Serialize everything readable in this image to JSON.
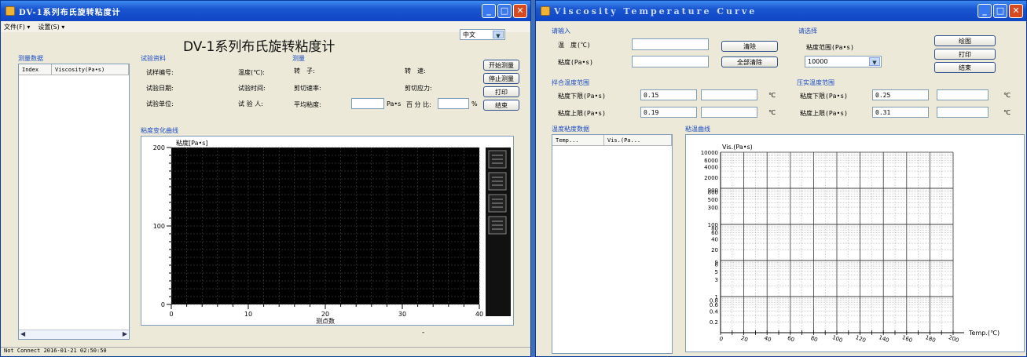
{
  "w1": {
    "title": "DV-1系列布氏旋转粘度计",
    "menu": [
      "文件(F) ▾",
      "设置(S) ▾"
    ],
    "lang": "中文",
    "big_title": "DV-1系列布氏旋转粘度计",
    "measure_data_group": "测量数据",
    "list_headers": [
      "Index",
      "Viscosity(Pa•s)"
    ],
    "test_info_group": "试验资料",
    "test_info": {
      "sample_no": "试样编号:",
      "temperature": "温度(℃):",
      "test_date": "试验日期:",
      "test_time": "试验时间:",
      "test_unit": "试验单位:",
      "tester": "试 验 人:"
    },
    "measure_group": "测量",
    "measure": {
      "rotor": "转　子:",
      "speed": "转　速:",
      "shear_rate": "剪切速率:",
      "shear_stress": "剪切应力:",
      "avg_visc": "平均粘度:",
      "unit_pas": "Pa•s",
      "percent": "百 分 比:",
      "pct_sym": "%"
    },
    "buttons": {
      "start": "开始测量",
      "stop": "停止测量",
      "print": "打印",
      "end": "结束"
    },
    "curve_group": "粘度变化曲线",
    "status": "Not Connect   2016-01-21 02:50:50"
  },
  "w1_chart": {
    "type": "line",
    "ylabel": "粘度[Pa•s]",
    "xlabel": "测点数",
    "xlim": [
      0,
      40
    ],
    "ylim": [
      0,
      200
    ],
    "x_ticks": [
      0,
      10,
      20,
      30,
      40
    ],
    "y_ticks": [
      0,
      100,
      200
    ],
    "grid": true,
    "series": []
  },
  "w2": {
    "title": "Viscosity Temperature Curve",
    "input_group": "请输入",
    "temp_label": "温　度(℃)",
    "visc_label": "粘度(Pa•s)",
    "clear": "清除",
    "clear_all": "全部清除",
    "choose_group": "请选择",
    "range_label": "粘度范围(Pa•s)",
    "range_value": "10000",
    "draw": "绘图",
    "print": "打印",
    "end": "结束",
    "mix_group": "拌合温度范围",
    "comp_group": "压实温度范围",
    "lower_label": "粘度下限(Pa•s)",
    "upper_label": "粘度上限(Pa•s)",
    "mix_lower": "0.15",
    "mix_upper": "0.19",
    "comp_lower": "0.25",
    "comp_upper": "0.31",
    "deg": "℃",
    "data_group": "温度粘度数据",
    "list_headers": [
      "Temp...",
      "Vis.(Pa..."
    ],
    "curve_group": "粘温曲线"
  },
  "w2_chart": {
    "type": "line",
    "ylabel": "Vis.(Pa•s)",
    "xlabel": "Temp.(℃)",
    "y_scale": "log",
    "y_tick_labels": [
      "10000",
      "6000",
      "4000",
      "2000",
      "900",
      "800",
      "500",
      "300",
      "100",
      "80",
      "60",
      "40",
      "20",
      "9",
      "8",
      "5",
      "3",
      "1",
      "0.8",
      "0.6",
      "0.4",
      "0.2"
    ],
    "x_ticks": [
      0,
      20,
      40,
      60,
      80,
      100,
      120,
      140,
      160,
      180,
      200
    ],
    "grid": true,
    "series": []
  }
}
